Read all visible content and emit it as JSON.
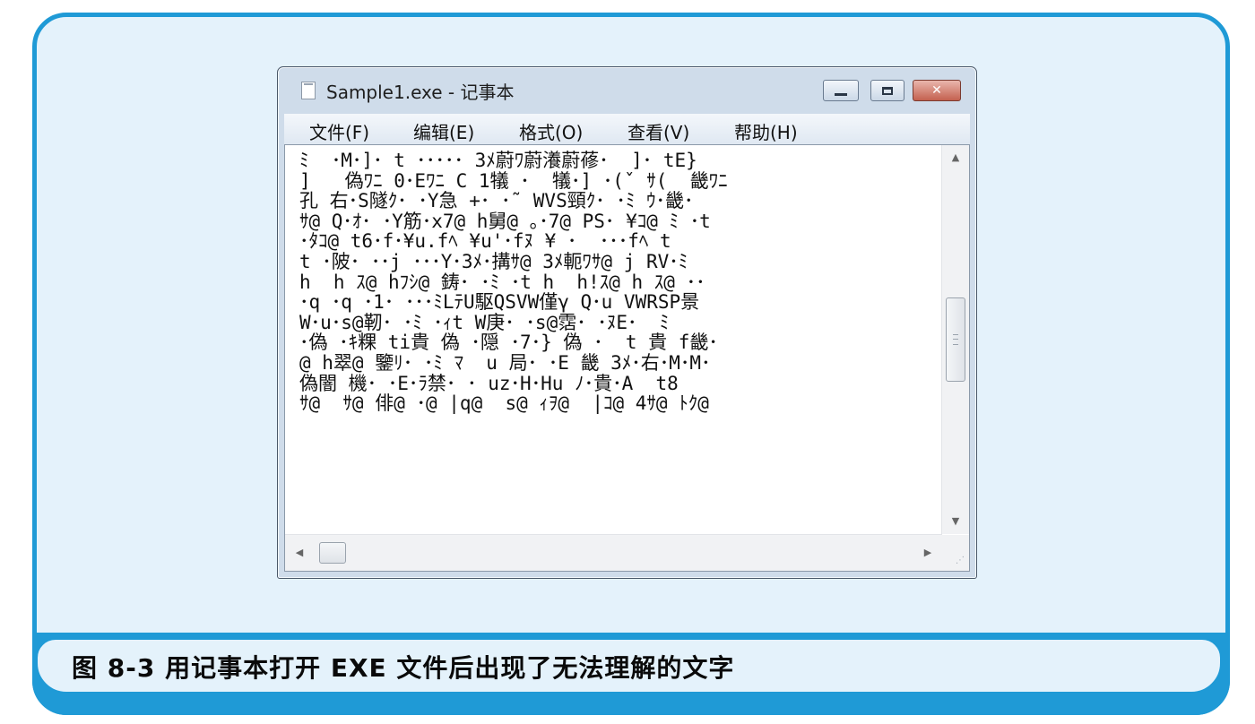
{
  "window": {
    "title": "Sample1.exe - 记事本",
    "controls": {
      "minimize": "minimize-icon",
      "maximize": "maximize-icon",
      "close": "✕"
    }
  },
  "menu": [
    "文件(F)",
    "编辑(E)",
    "格式(O)",
    "查看(V)",
    "帮助(H)"
  ],
  "editor": {
    "text": "ﾐ  ･M･]･ t ･････ 3ﾒ蔚ﾜ蔚瀁蔚蓚･  ]･ tE}\n]   偽ﾜﾆ 0･Eﾜﾆ C 1犠 ･  犠･] ･(ˇ ｻ(  畿ﾜﾆ\n孔 右･S隧ｸ･ ･Y急 +･ ･˜ WVS頸ｸ･ ･ﾐ ｳ･畿･\nｻ@ Q･ｵ･ ･Y筋･x7@ h舅@ ｡･7@ PS･ ¥ｺ@ ﾐ ･t\n･ﾀｺ@ t6･f･¥u.fﾍ ¥u'･fﾇ ¥ ･  ･･･fﾍ t\nt ･陂･ ･･j ･･･Y･3ﾒ･搆ｻ@ 3ﾒ軛ﾜｻ@ j RV･ﾐ\nh  h ｽ@ hﾌｼ@ 鋳･ ･ﾐ ･t h  h!ｽ@ h ｽ@ ･･\n･q ･q ･1･ ･･･ﾐLﾃU駆QSVW僅γ Q･u VWRSP景\nW･u･s@靭･ ･ﾐ ･ｨt W庚･ ･s@霑･ ･ﾇE･  ﾐ\n･偽 ･ｷ粿 ti貴 偽 ･隠 ･7･} 偽 ･  t 貴 f畿･\n@ h翠@ 鑒ﾘ･ ･ﾐ ﾏ  u 局･ ･E 畿 3ﾒ･右･M･M･\n偽闇 機･ ･E･ﾗ禁･ ･ uz･H･Hu ﾉ･貴･A  t8\nｻ@  ｻ@ 俳@ ･@ |q@  s@ ｨｦ@  |ｺ@ 4ｻ@ ﾄｸ@",
    "scroll_position_fraction": 0.5
  },
  "caption": "图 8-3    用记事本打开 EXE 文件后出现了无法理解的文字",
  "colors": {
    "frame_border": "#1f9ad6",
    "frame_fill": "#e4f2fb"
  }
}
